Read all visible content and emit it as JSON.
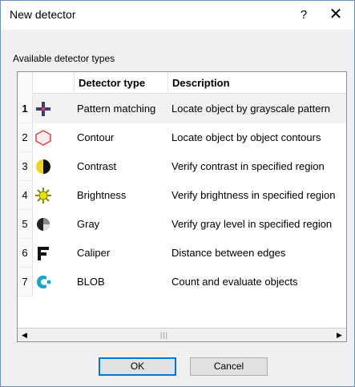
{
  "window": {
    "title": "New detector",
    "help_label": "?",
    "close_label": "✕"
  },
  "section_label": "Available detector types",
  "table": {
    "columns": [
      "Detector type",
      "Description"
    ],
    "rows": [
      {
        "index": "1",
        "icon": "pattern-matching-cross-icon",
        "type": "Pattern matching",
        "description": "Locate object by grayscale pattern"
      },
      {
        "index": "2",
        "icon": "contour-hexagon-icon",
        "type": "Contour",
        "description": "Locate object by object contours"
      },
      {
        "index": "3",
        "icon": "contrast-half-circle-icon",
        "type": "Contrast",
        "description": "Verify contrast in specified region"
      },
      {
        "index": "4",
        "icon": "brightness-sun-icon",
        "type": "Brightness",
        "description": "Verify brightness in specified region"
      },
      {
        "index": "5",
        "icon": "gray-circle-icon",
        "type": "Gray",
        "description": "Verify gray level in specified region"
      },
      {
        "index": "6",
        "icon": "caliper-icon",
        "type": "Caliper",
        "description": "Distance between edges"
      },
      {
        "index": "7",
        "icon": "blob-icon",
        "type": "BLOB",
        "description": "Count and evaluate objects"
      }
    ],
    "selected_row": 1
  },
  "scrollbar": {
    "left_arrow": "◀",
    "right_arrow": "▶",
    "grip": "|||"
  },
  "buttons": {
    "ok": "OK",
    "cancel": "Cancel"
  },
  "colors": {
    "dialog_border": "#6d8fbd",
    "ok_focus": "#0078d7",
    "pattern_cross": "#3b3f6f",
    "contour_red": "#d24a4a",
    "contrast_yellow": "#f2d21b",
    "brightness_yellow": "#e8e000",
    "blob_cyan": "#1aa6c9"
  }
}
